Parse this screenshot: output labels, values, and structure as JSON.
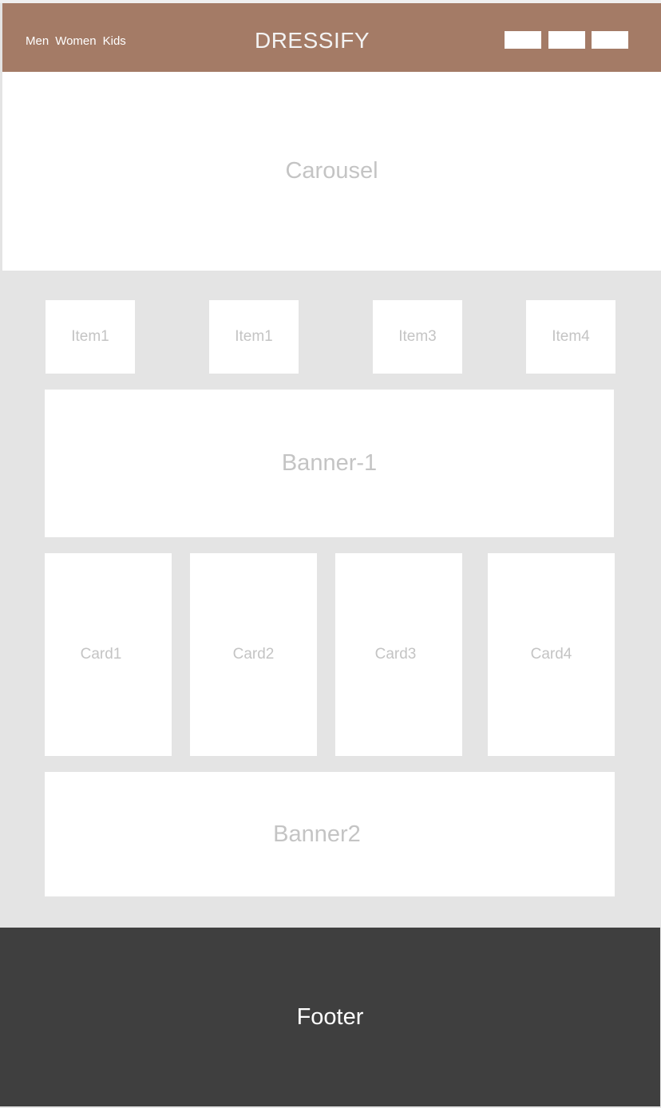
{
  "header": {
    "nav": [
      "Men",
      "Women",
      "Kids"
    ],
    "brand": "DRESSIFY"
  },
  "carousel": {
    "label": "Carousel"
  },
  "items": [
    "Item1",
    "Item1",
    "Item3",
    "Item4"
  ],
  "banner1": {
    "label": "Banner-1"
  },
  "cards": [
    "Card1",
    "Card2",
    "Card3",
    "Card4"
  ],
  "banner2": {
    "label": "Banner2"
  },
  "footer": {
    "label": "Footer"
  },
  "colors": {
    "header_bg": "#a47b66",
    "page_bg": "#e4e4e4",
    "footer_bg": "#3f3f3f",
    "placeholder_text": "#c4c4c4"
  }
}
